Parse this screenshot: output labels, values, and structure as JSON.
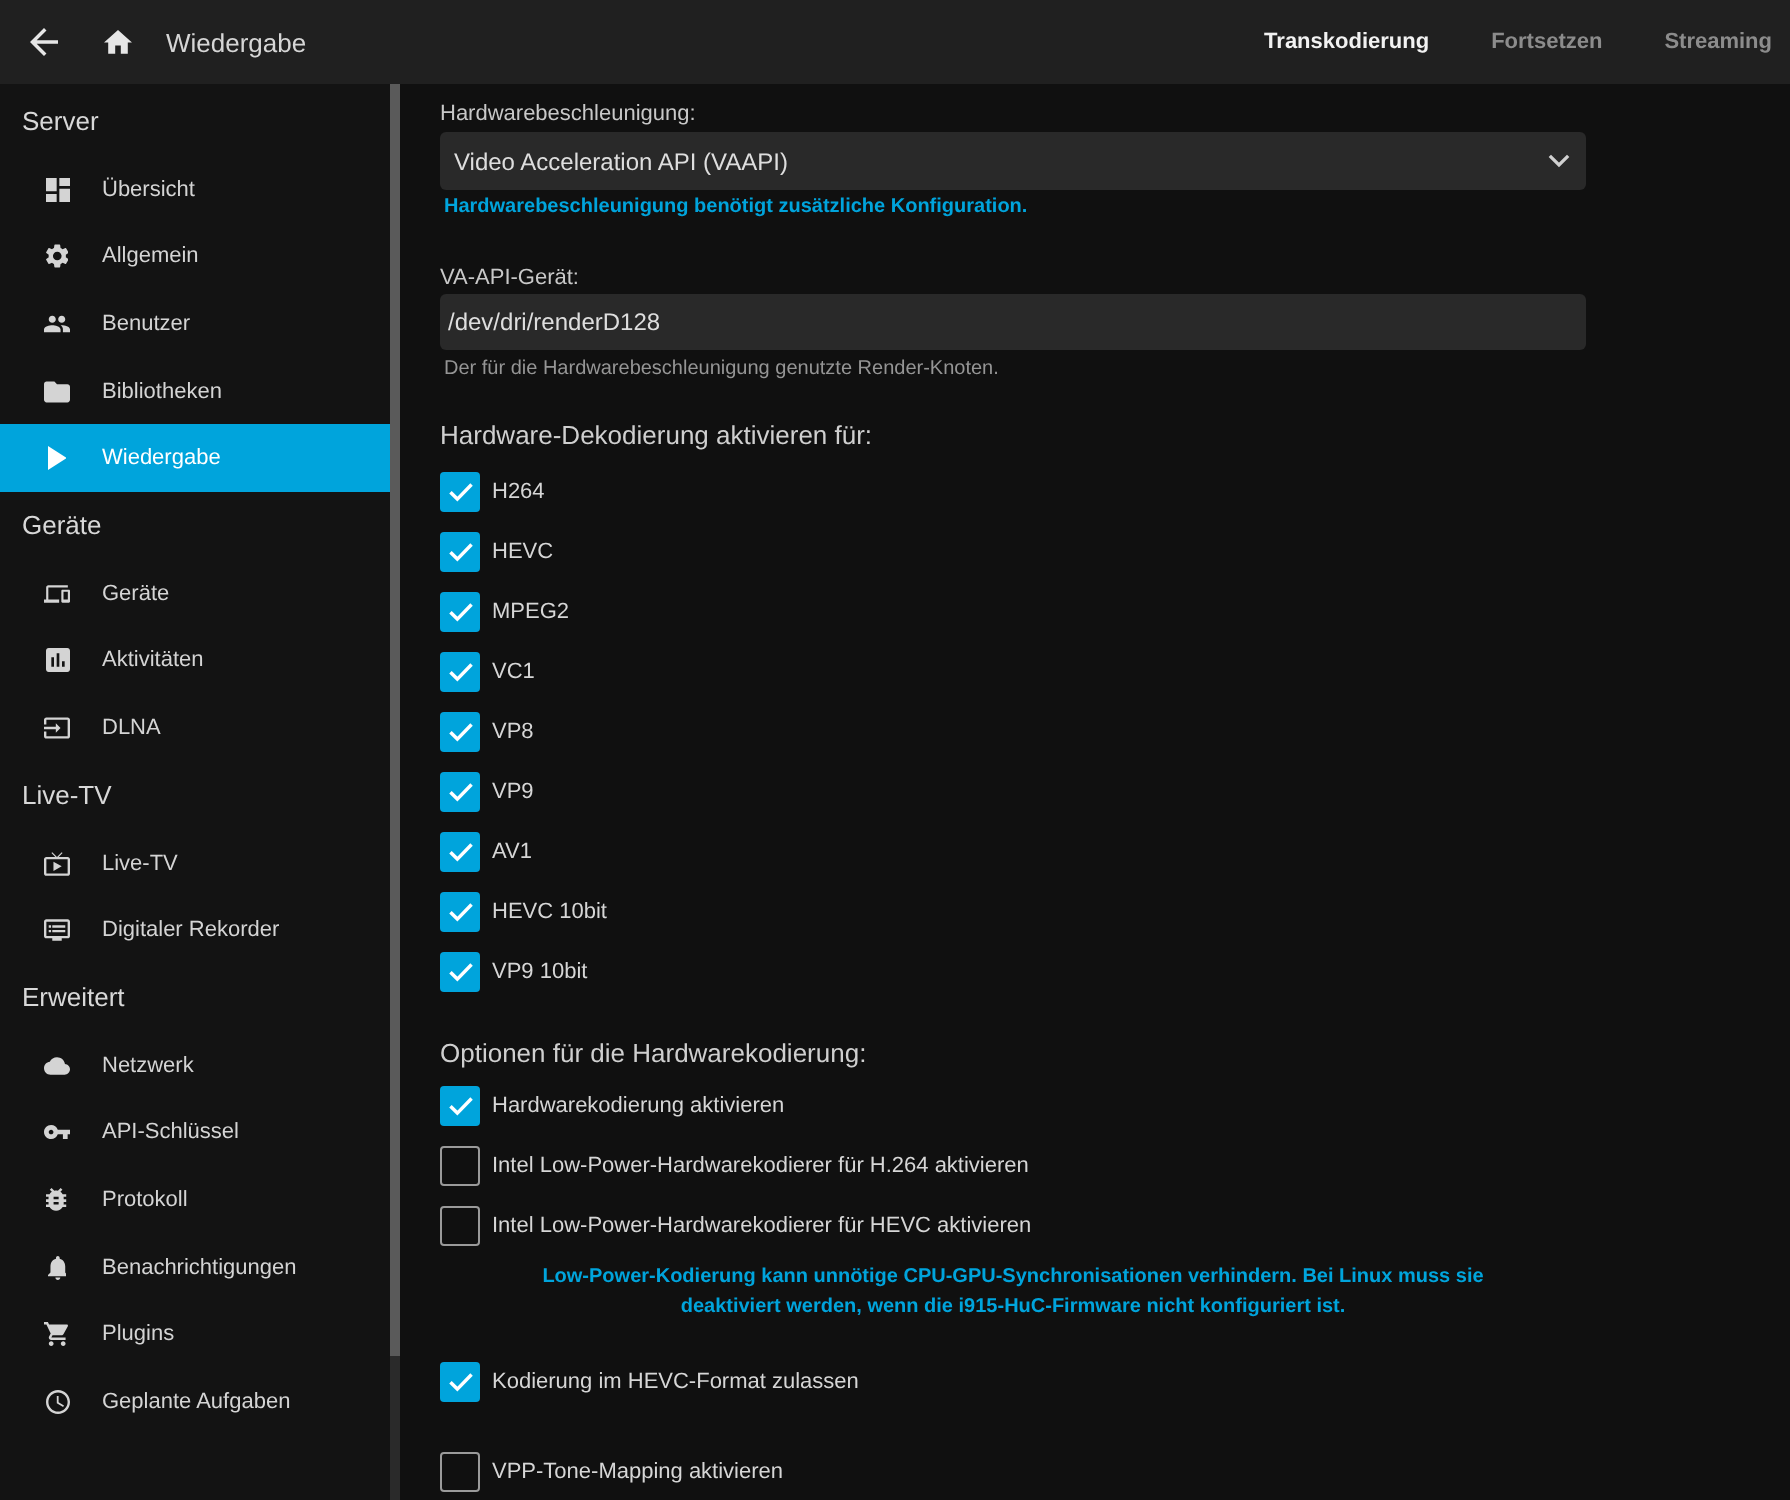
{
  "header": {
    "title": "Wiedergabe",
    "tabs": [
      {
        "label": "Transkodierung",
        "selected": true
      },
      {
        "label": "Fortsetzen",
        "selected": false
      },
      {
        "label": "Streaming",
        "selected": false
      }
    ]
  },
  "sidebar": {
    "sections": [
      {
        "heading": "Server",
        "items": [
          {
            "label": "Übersicht",
            "selected": false
          },
          {
            "label": "Allgemein",
            "selected": false
          },
          {
            "label": "Benutzer",
            "selected": false
          },
          {
            "label": "Bibliotheken",
            "selected": false
          },
          {
            "label": "Wiedergabe",
            "selected": true
          }
        ]
      },
      {
        "heading": "Geräte",
        "items": [
          {
            "label": "Geräte",
            "selected": false
          },
          {
            "label": "Aktivitäten",
            "selected": false
          },
          {
            "label": "DLNA",
            "selected": false
          }
        ]
      },
      {
        "heading": "Live-TV",
        "items": [
          {
            "label": "Live-TV",
            "selected": false
          },
          {
            "label": "Digitaler Rekorder",
            "selected": false
          }
        ]
      },
      {
        "heading": "Erweitert",
        "items": [
          {
            "label": "Netzwerk",
            "selected": false
          },
          {
            "label": "API-Schlüssel",
            "selected": false
          },
          {
            "label": "Protokoll",
            "selected": false
          },
          {
            "label": "Benachrichtigungen",
            "selected": false
          },
          {
            "label": "Plugins",
            "selected": false
          },
          {
            "label": "Geplante Aufgaben",
            "selected": false
          }
        ]
      }
    ]
  },
  "acceleration": {
    "label": "Hardwarebeschleunigung:",
    "value": "Video Acceleration API (VAAPI)",
    "note": "Hardwarebeschleunigung benötigt zusätzliche Konfiguration."
  },
  "device": {
    "label": "VA-API-Gerät:",
    "value": "/dev/dri/renderD128",
    "help": "Der für die Hardwarebeschleunigung genutzte Render-Knoten."
  },
  "decoding": {
    "heading": "Hardware-Dekodierung aktivieren für:",
    "options": [
      {
        "label": "H264",
        "checked": true
      },
      {
        "label": "HEVC",
        "checked": true
      },
      {
        "label": "MPEG2",
        "checked": true
      },
      {
        "label": "VC1",
        "checked": true
      },
      {
        "label": "VP8",
        "checked": true
      },
      {
        "label": "VP9",
        "checked": true
      },
      {
        "label": "AV1",
        "checked": true
      },
      {
        "label": "HEVC 10bit",
        "checked": true
      },
      {
        "label": "VP9 10bit",
        "checked": true
      }
    ]
  },
  "encoding": {
    "heading": "Optionen für die Hardwarekodierung:",
    "items": [
      {
        "kind": "checkbox",
        "label": "Hardwarekodierung aktivieren",
        "checked": true
      },
      {
        "kind": "checkbox",
        "label": "Intel Low-Power-Hardwarekodierer für H.264 aktivieren",
        "checked": false
      },
      {
        "kind": "checkbox",
        "label": "Intel Low-Power-Hardwarekodierer für HEVC aktivieren",
        "checked": false
      },
      {
        "kind": "note",
        "text": "Low-Power-Kodierung kann unnötige CPU-GPU-Synchronisationen verhindern. Bei Linux muss sie deaktiviert werden, wenn die i915-HuC-Firmware nicht konfiguriert ist."
      },
      {
        "kind": "checkbox",
        "label": "Kodierung im HEVC-Format zulassen",
        "checked": true
      },
      {
        "kind": "checkbox",
        "label": "VPP-Tone-Mapping aktivieren",
        "checked": false
      }
    ]
  }
}
